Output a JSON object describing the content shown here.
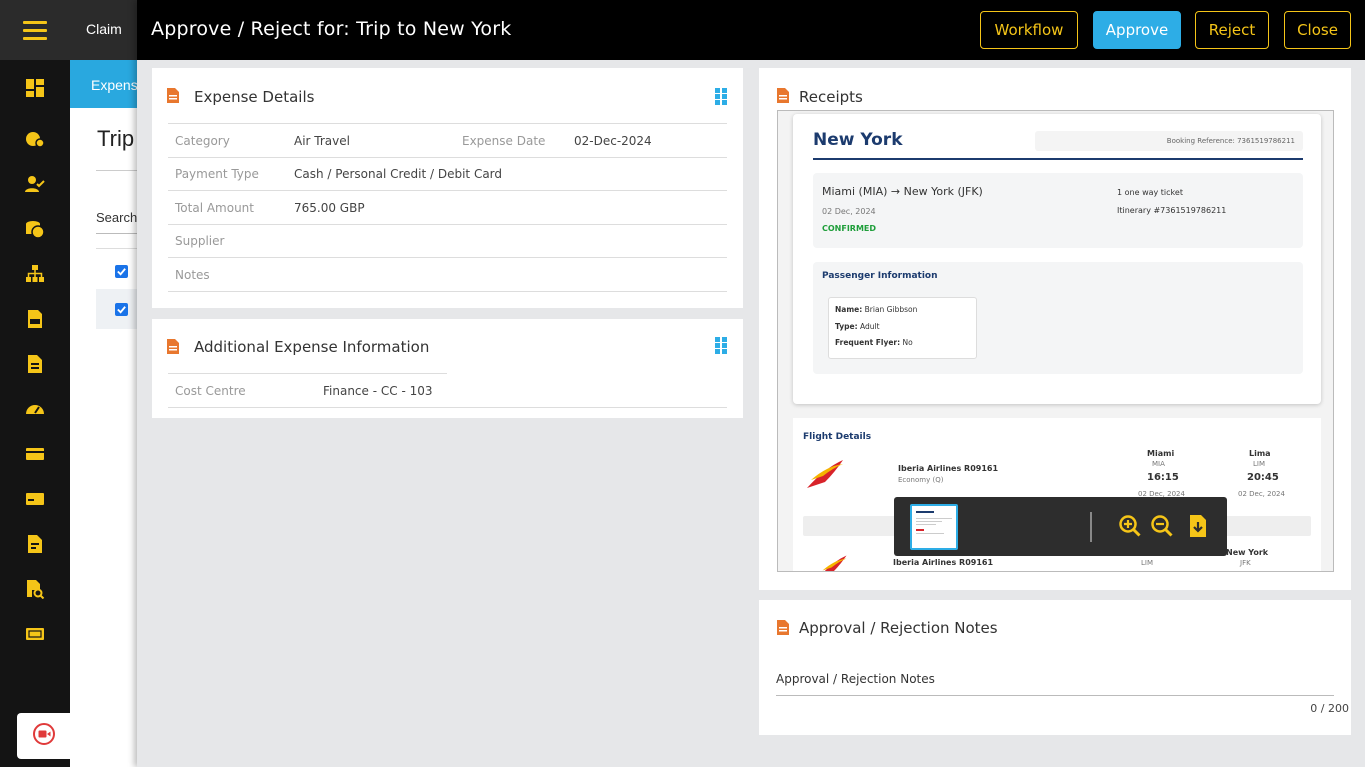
{
  "background_page": {
    "header_label": "Claim",
    "tab_label": "Expenses",
    "page_title": "Trip",
    "search_label": "Search"
  },
  "dialog": {
    "title": "Approve / Reject for: Trip to New York",
    "buttons": {
      "workflow": "Workflow",
      "approve": "Approve",
      "reject": "Reject",
      "close": "Close"
    }
  },
  "expense_details": {
    "title": "Expense Details",
    "category_label": "Category",
    "category_value": "Air Travel",
    "expense_date_label": "Expense Date",
    "expense_date_value": "02-Dec-2024",
    "payment_type_label": "Payment Type",
    "payment_type_value": "Cash / Personal Credit / Debit Card",
    "total_amount_label": "Total Amount",
    "total_amount_value": "765.00 GBP",
    "supplier_label": "Supplier",
    "notes_label": "Notes"
  },
  "additional_info": {
    "title": "Additional Expense Information",
    "cost_centre_label": "Cost Centre",
    "cost_centre_value": "Finance - CC - 103"
  },
  "receipts": {
    "title": "Receipts",
    "receipt": {
      "city": "New York",
      "booking_reference": "Booking Reference: 7361519786211",
      "route": "Miami (MIA) → New York (JFK)",
      "date": "02 Dec, 2024",
      "status": "CONFIRMED",
      "ticket": "1 one way ticket",
      "itinerary": "Itinerary #7361519786211",
      "passenger_heading": "Passenger Information",
      "name_label": "Name:",
      "name_value": "Brian Gibbson",
      "type_label": "Type:",
      "type_value": "Adult",
      "flyer_label": "Frequent Flyer:",
      "flyer_value": "No",
      "flight_heading": "Flight Details",
      "airline": "Iberia Airlines R09161",
      "cabin": "Economy (Q)",
      "from_city": "Miami",
      "from_code": "MIA",
      "from_time": "16:15",
      "from_date": "02 Dec, 2024",
      "to_city": "Lima",
      "to_code": "LIM",
      "to_time": "20:45",
      "to_date": "02 Dec, 2024",
      "airline2": "Iberia Airlines R09161",
      "leg2_from_code": "LIM",
      "leg2_to_city": "New York",
      "leg2_to_code": "JFK"
    },
    "viewer_icons": [
      "zoom-in-icon",
      "zoom-out-icon",
      "download-icon"
    ]
  },
  "approval_notes": {
    "title": "Approval / Rejection Notes",
    "field_label": "Approval / Rejection Notes",
    "char_count": "0 / 200"
  },
  "colors": {
    "accent_yellow": "#f5c518",
    "approve_blue": "#2dade6",
    "doc_icon_orange": "#e8772e",
    "grid_icon_blue": "#2dade6"
  }
}
